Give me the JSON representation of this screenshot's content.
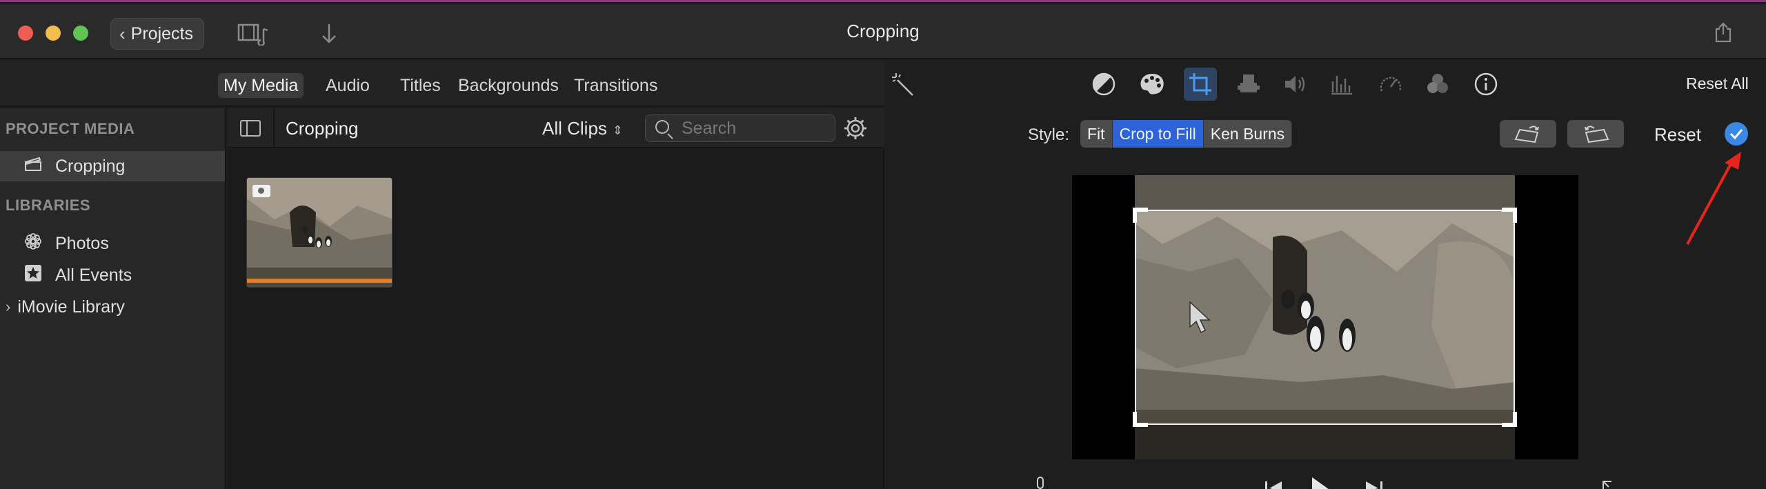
{
  "window": {
    "title": "Cropping",
    "back_label": "Projects"
  },
  "media_nav": {
    "tabs": [
      {
        "label": "My Media",
        "active": true
      },
      {
        "label": "Audio",
        "active": false
      },
      {
        "label": "Titles",
        "active": false
      },
      {
        "label": "Backgrounds",
        "active": false
      },
      {
        "label": "Transitions",
        "active": false
      }
    ]
  },
  "sidebar": {
    "project_media_heading": "PROJECT MEDIA",
    "project_items": [
      {
        "label": "Cropping",
        "icon": "clapper-icon",
        "selected": true
      }
    ],
    "libraries_heading": "LIBRARIES",
    "library_items": [
      {
        "label": "Photos",
        "icon": "photos-icon"
      },
      {
        "label": "All Events",
        "icon": "star-icon"
      },
      {
        "label": "iMovie Library",
        "icon": "disclosure-icon"
      }
    ]
  },
  "browser": {
    "title": "Cropping",
    "filter_value": "All Clips",
    "search_placeholder": "Search"
  },
  "viewer": {
    "reset_all_label": "Reset All",
    "style_label": "Style:",
    "style_options": [
      {
        "label": "Fit",
        "active": false
      },
      {
        "label": "Crop to Fill",
        "active": true
      },
      {
        "label": "Ken Burns",
        "active": false
      }
    ],
    "reset_label": "Reset",
    "adjust_tools": [
      "color-balance-icon",
      "color-correction-icon",
      "crop-icon",
      "stabilization-icon",
      "volume-icon",
      "equalizer-icon",
      "speed-icon",
      "clip-filter-icon",
      "info-icon"
    ]
  },
  "colors": {
    "accent": "#2c63d8",
    "apply_blue": "#3a87e6",
    "clip_bar": "#e87c22",
    "annotation_arrow": "#e8241c"
  }
}
